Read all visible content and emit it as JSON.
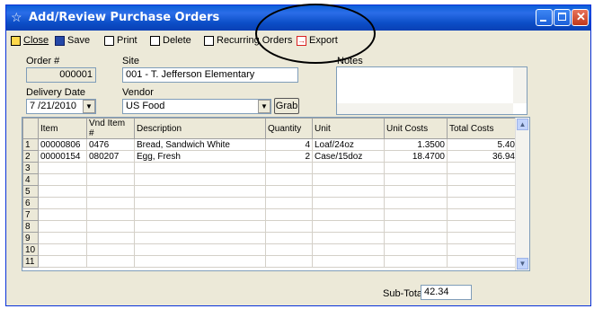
{
  "window": {
    "title": "Add/Review Purchase Orders"
  },
  "toolbar": {
    "close": "Close",
    "save": "Save",
    "print": "Print",
    "delete": "Delete",
    "recurring_orders": "Recurring Orders",
    "export": "Export"
  },
  "form": {
    "order_label": "Order #",
    "order_value": "000001",
    "site_label": "Site",
    "site_value": "001 - T. Jefferson Elementary",
    "notes_label": "Notes",
    "delivery_label": "Delivery Date",
    "delivery_value": "7 /21/2010",
    "vendor_label": "Vendor",
    "vendor_value": "US Food",
    "grab": "Grab"
  },
  "grid": {
    "headers": [
      "Item",
      "Vnd Item #",
      "Description",
      "Quantity",
      "Unit",
      "Unit Costs",
      "Total Costs"
    ],
    "rows": [
      {
        "n": "1",
        "item": "00000806",
        "vnd": "0476",
        "desc": "Bread, Sandwich White",
        "qty": "4",
        "unit": "Loaf/24oz",
        "ucost": "1.3500",
        "tcost": "5.40"
      },
      {
        "n": "2",
        "item": "00000154",
        "vnd": "080207",
        "desc": "Egg, Fresh",
        "qty": "2",
        "unit": "Case/15doz",
        "ucost": "18.4700",
        "tcost": "36.94"
      },
      {
        "n": "3"
      },
      {
        "n": "4"
      },
      {
        "n": "5"
      },
      {
        "n": "6"
      },
      {
        "n": "7"
      },
      {
        "n": "8"
      },
      {
        "n": "9"
      },
      {
        "n": "10"
      },
      {
        "n": "11"
      }
    ]
  },
  "footer": {
    "subtotal_label": "Sub-Total",
    "subtotal_value": "42.34"
  },
  "colors": {
    "titlebar": "#0a5fd8",
    "window_bg": "#ece9d8",
    "export_icon": "#d92020",
    "annotation": "#000000"
  },
  "icons": [
    "star-icon",
    "minimize-icon",
    "maximize-icon",
    "close-icon",
    "close-doc-icon",
    "save-disk-icon",
    "printer-icon",
    "delete-icon",
    "recurring-icon",
    "export-icon",
    "chevron-down-icon"
  ]
}
